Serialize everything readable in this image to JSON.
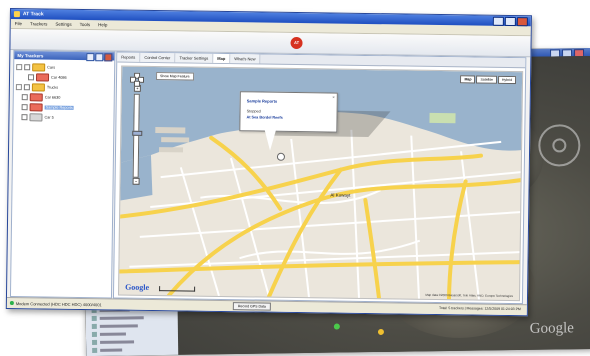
{
  "app": {
    "title": "AT Track",
    "logo_text": "AT"
  },
  "menu": {
    "items": [
      "File",
      "Trackers",
      "Settings",
      "Tools",
      "Help"
    ]
  },
  "trackers_panel": {
    "title": "My Trackers",
    "nodes": [
      {
        "label": "Cars",
        "tag": "folder",
        "level": 0
      },
      {
        "label": "Car 4086",
        "tag": "vehicle",
        "level": 1
      },
      {
        "label": "Trucks",
        "tag": "folder",
        "level": 0
      },
      {
        "label": "Car 6630",
        "tag": "vehicle",
        "level": 0
      },
      {
        "label": "Sample Reports",
        "tag": "vehicle",
        "level": 0,
        "selected": true
      },
      {
        "label": "Car 5",
        "tag": "gray",
        "level": 0
      }
    ]
  },
  "tabs": [
    "Reports",
    "Control Center",
    "Tracker Settings",
    "Map",
    "What's New"
  ],
  "active_tab": "Map",
  "map": {
    "satellite_button": "Show Map Feature",
    "map_types": [
      "Map",
      "Satellite",
      "Hybrid"
    ],
    "active_map_type": "Map",
    "zoom_in": "+",
    "zoom_out": "−",
    "bubble": {
      "title": "Sample Reports",
      "status": "Stopped",
      "link": "At Sea Bordel Reefs",
      "close": "×"
    },
    "city_label": "Al Kuwayt",
    "google_logo": "Google",
    "copyright": "Map data ©2009 Basarsoft, Tele Atlas, AND, Europa Technologies"
  },
  "status_bar": {
    "connection": "Modem Connected (HDC HDC HDC) 4000/4001",
    "button": "Record GPS Data",
    "right": "Total: 5 trackers | Messages: 12/5/2009 01:24:03 PM"
  },
  "back_window": {
    "watermark": "Google",
    "panel_rows": 7
  },
  "colors": {
    "titlebar": "#2f5fcc",
    "folder": "#f3c243",
    "vehicle": "#ea6b5a",
    "water": "#99b3cc",
    "road_major": "#f7d24c",
    "map_bg": "#ebe6dc"
  }
}
